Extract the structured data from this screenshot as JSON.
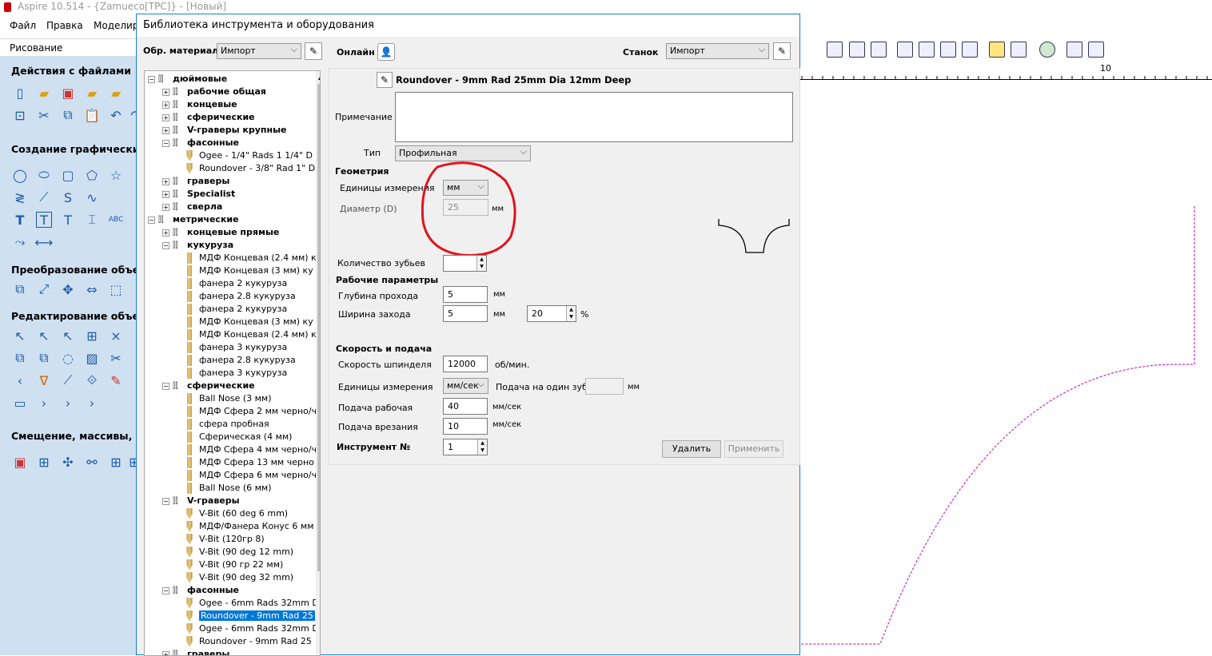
{
  "app": {
    "title": "Aspire 10.514 - {Zamueco[TPC]} - [Новый]"
  },
  "menu": [
    "Файл",
    "Правка",
    "Моделир"
  ],
  "left_panel": {
    "header": "Рисование",
    "sections": [
      "Действия с файлами",
      "Создание графических э",
      "Преобразование объект",
      "Редактирование объекто",
      "Смещение, массивы, ко"
    ]
  },
  "ruler": {
    "mark": "10"
  },
  "dialog": {
    "title": "Библиотека инструмента и оборудования",
    "material_label": "Обр. материал",
    "material_value": "Импорт",
    "online_label": "Онлайн",
    "machine_label": "Станок",
    "machine_value": "Импорт",
    "tool_name": "Roundover -  9mm Rad 25mm Dia 12mm Deep",
    "note_label": "Примечание",
    "type_label": "Тип",
    "type_value": "Профильная",
    "geometry_header": "Геометрия",
    "units_label": "Единицы измерения",
    "units_value": "мм",
    "diameter_label": "Диаметр (D)",
    "diameter_value": "25",
    "diameter_unit": "мм",
    "teeth_label": "Количество зубьев",
    "teeth_value": "",
    "work_params_header": "Рабочие параметры",
    "pass_depth_label": "Глубина прохода",
    "pass_depth_value": "5",
    "pass_depth_unit": "мм",
    "stepover_label": "Ширина захода",
    "stepover_value": "5",
    "stepover_unit": "мм",
    "stepover_pct_value": "20",
    "stepover_pct_unit": "%",
    "feeds_header": "Скорость и подача",
    "spindle_label": "Скорость шпинделя",
    "spindle_value": "12000",
    "spindle_unit": "об/мин.",
    "feed_units_label": "Единицы измерения",
    "feed_units_value": "мм/сек",
    "per_tooth_label": "Подача на один зуб",
    "per_tooth_value": "",
    "per_tooth_unit": "мм",
    "feed_rate_label": "Подача рабочая",
    "feed_rate_value": "40",
    "feed_rate_unit": "мм/сек",
    "plunge_label": "Подача врезания",
    "plunge_value": "10",
    "plunge_unit": "мм/сек",
    "tool_no_label": "Инструмент №",
    "tool_no_value": "1",
    "delete_label": "Удалить",
    "apply_label": "Применить"
  },
  "tree": [
    {
      "level": 0,
      "kind": "group",
      "exp": "−",
      "text": "дюймовые"
    },
    {
      "level": 1,
      "kind": "group",
      "exp": "+",
      "text": "рабочие общая"
    },
    {
      "level": 1,
      "kind": "group",
      "exp": "+",
      "text": "концевые"
    },
    {
      "level": 1,
      "kind": "group",
      "exp": "+",
      "text": "сферические"
    },
    {
      "level": 1,
      "kind": "group",
      "exp": "+",
      "text": "V-граверы крупные"
    },
    {
      "level": 1,
      "kind": "group",
      "exp": "−",
      "text": "фасонные"
    },
    {
      "level": 2,
      "kind": "bit",
      "text": "Ogee - 1/4\" Rads 1 1/4\" D"
    },
    {
      "level": 2,
      "kind": "bit",
      "text": "Roundover - 3/8\" Rad 1\" D"
    },
    {
      "level": 1,
      "kind": "group",
      "exp": "+",
      "text": "граверы"
    },
    {
      "level": 1,
      "kind": "group",
      "exp": "+",
      "text": "Specialist"
    },
    {
      "level": 1,
      "kind": "group",
      "exp": "+",
      "text": "сверла"
    },
    {
      "level": 0,
      "kind": "group",
      "exp": "−",
      "text": "метрические"
    },
    {
      "level": 1,
      "kind": "group",
      "exp": "+",
      "text": "концевые прямые"
    },
    {
      "level": 1,
      "kind": "group",
      "exp": "−",
      "text": "кукуруза"
    },
    {
      "level": 2,
      "kind": "straight",
      "text": "МДФ Концевая (2.4 мм) к"
    },
    {
      "level": 2,
      "kind": "straight",
      "text": "МДФ Концевая (3 мм) ку"
    },
    {
      "level": 2,
      "kind": "straight",
      "text": "фанера 2 кукуруза"
    },
    {
      "level": 2,
      "kind": "straight",
      "text": "фанера 2.8 кукуруза"
    },
    {
      "level": 2,
      "kind": "straight",
      "text": "фанера 2 кукуруза"
    },
    {
      "level": 2,
      "kind": "straight",
      "text": "МДФ Концевая (3 мм) ку"
    },
    {
      "level": 2,
      "kind": "straight",
      "text": "МДФ Концевая (2.4 мм) к"
    },
    {
      "level": 2,
      "kind": "straight",
      "text": "фанера 3 кукуруза"
    },
    {
      "level": 2,
      "kind": "straight",
      "text": "фанера 2.8 кукуруза"
    },
    {
      "level": 2,
      "kind": "straight",
      "text": "фанера 3 кукуруза"
    },
    {
      "level": 1,
      "kind": "group",
      "exp": "−",
      "text": "сферические"
    },
    {
      "level": 2,
      "kind": "straight",
      "text": "Ball Nose (3 мм)"
    },
    {
      "level": 2,
      "kind": "straight",
      "text": "МДФ Сфера 2 мм черно/ч"
    },
    {
      "level": 2,
      "kind": "straight",
      "text": "сфера пробная"
    },
    {
      "level": 2,
      "kind": "straight",
      "text": "Сферическая (4 мм)"
    },
    {
      "level": 2,
      "kind": "straight",
      "text": "МДФ Сфера 4 мм черно/ч"
    },
    {
      "level": 2,
      "kind": "straight",
      "text": "МДФ Сфера 13 мм черно"
    },
    {
      "level": 2,
      "kind": "straight",
      "text": "МДФ Сфера 6 мм черно/ч"
    },
    {
      "level": 2,
      "kind": "straight",
      "text": "Ball Nose (6 мм)"
    },
    {
      "level": 1,
      "kind": "group",
      "exp": "−",
      "text": "V-граверы"
    },
    {
      "level": 2,
      "kind": "bit",
      "text": "V-Bit (60 deg 6 mm)"
    },
    {
      "level": 2,
      "kind": "bit",
      "text": "МДФ/Фанера Конус 6 мм"
    },
    {
      "level": 2,
      "kind": "bit",
      "text": "V-Bit (120гр 8)"
    },
    {
      "level": 2,
      "kind": "bit",
      "text": "V-Bit (90 deg 12 mm)"
    },
    {
      "level": 2,
      "kind": "bit",
      "text": "V-Bit (90 гр 22 мм)"
    },
    {
      "level": 2,
      "kind": "bit",
      "text": "V-Bit (90 deg 32 mm)"
    },
    {
      "level": 1,
      "kind": "group",
      "exp": "−",
      "text": "фасонные"
    },
    {
      "level": 2,
      "kind": "bit",
      "text": "Ogee - 6mm Rads 32mm D"
    },
    {
      "level": 2,
      "kind": "bit",
      "text": "Roundover -  9mm Rad 25",
      "selected": true
    },
    {
      "level": 2,
      "kind": "bit",
      "text": "Ogee - 6mm Rads 32mm D"
    },
    {
      "level": 2,
      "kind": "bit",
      "text": "Roundover -  9mm Rad 25"
    },
    {
      "level": 1,
      "kind": "group",
      "exp": "+",
      "text": "граверы"
    }
  ],
  "colors": {
    "accent": "#0078d7",
    "panel": "#cfe0f1",
    "annotation": "#e0141e",
    "toolpath": "#c000c0"
  }
}
